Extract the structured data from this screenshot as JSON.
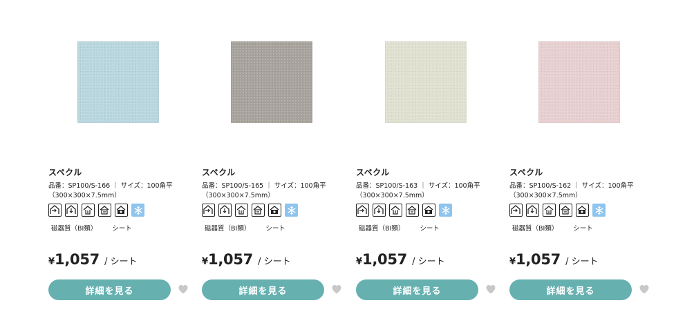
{
  "products": [
    {
      "title": "スペクル",
      "spec_line1": "品番：SP100/S-166 ｜ サイズ：100角平",
      "spec_line2": "（300×300×7.5mm）",
      "material": "磁器質（BI類）",
      "sheet": "シート",
      "currency": "¥",
      "price": "1,057",
      "unit": "/ シート",
      "button": "詳細を見る",
      "swatch_color": "#b8d6de"
    },
    {
      "title": "スペクル",
      "spec_line1": "品番：SP100/S-165 ｜ サイズ：100角平",
      "spec_line2": "（300×300×7.5mm）",
      "material": "磁器質（BI類）",
      "sheet": "シート",
      "currency": "¥",
      "price": "1,057",
      "unit": "/ シート",
      "button": "詳細を見る",
      "swatch_color": "#a6a19b"
    },
    {
      "title": "スペクル",
      "spec_line1": "品番：SP100/S-163 ｜ サイズ：100角平",
      "spec_line2": "（300×300×7.5mm）",
      "material": "磁器質（BI類）",
      "sheet": "シート",
      "currency": "¥",
      "price": "1,057",
      "unit": "/ シート",
      "button": "詳細を見る",
      "swatch_color": "#dfe0d0"
    },
    {
      "title": "スペクル",
      "spec_line1": "品番：SP100/S-162 ｜ サイズ：100角平",
      "spec_line2": "（300×300×7.5mm）",
      "material": "磁器質（BI類）",
      "sheet": "シート",
      "currency": "¥",
      "price": "1,057",
      "unit": "/ シート",
      "button": "詳細を見る",
      "swatch_color": "#e7cfd0"
    }
  ],
  "usage_icons": [
    "exterior-wall-icon",
    "exterior-floor-icon",
    "interior-floor-icon",
    "interior-wall-icon",
    "wet-area-icon",
    "frost-resistant-icon"
  ],
  "colors": {
    "button": "#66b0b0",
    "heart": "#c8c8c8",
    "frost_icon_bg": "#8ec5ee"
  }
}
